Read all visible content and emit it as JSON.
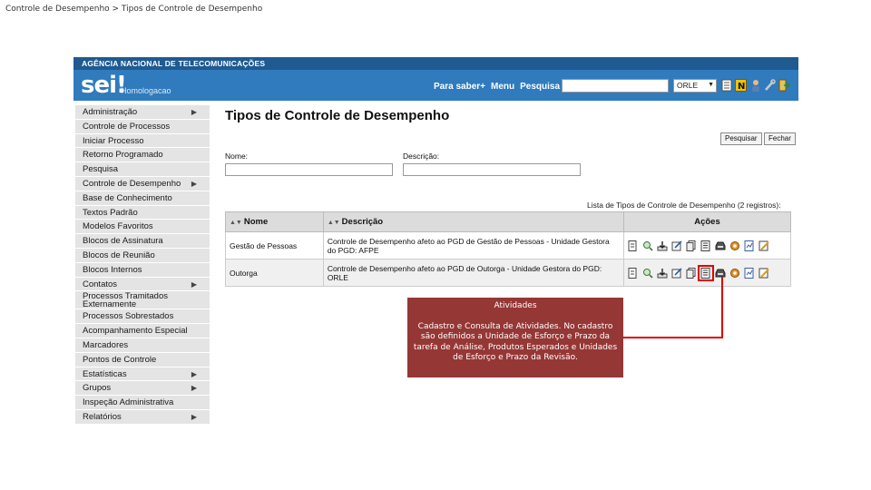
{
  "slide": {
    "title": "Controle de Desempenho > Tipos de Controle de Desempenho"
  },
  "header": {
    "agency": "AGÊNCIA NACIONAL DE TELECOMUNICAÇÕES",
    "logo": "sei!",
    "environment": "Homologacao",
    "links": [
      "Para saber+",
      "Menu",
      "Pesquisa"
    ],
    "search_value": "",
    "unit_value": "ORLE",
    "toolbar_icons": [
      "notes-icon",
      "n-icon",
      "user-icon",
      "tools-icon",
      "exit-icon"
    ]
  },
  "sidebar": {
    "items": [
      {
        "label": "Administração",
        "submenu": true
      },
      {
        "label": "Controle de Processos",
        "submenu": false
      },
      {
        "label": "Iniciar Processo",
        "submenu": false
      },
      {
        "label": "Retorno Programado",
        "submenu": false
      },
      {
        "label": "Pesquisa",
        "submenu": false
      },
      {
        "label": "Controle de Desempenho",
        "submenu": true
      },
      {
        "label": "Base de Conhecimento",
        "submenu": false
      },
      {
        "label": "Textos Padrão",
        "submenu": false
      },
      {
        "label": "Modelos Favoritos",
        "submenu": false
      },
      {
        "label": "Blocos de Assinatura",
        "submenu": false
      },
      {
        "label": "Blocos de Reunião",
        "submenu": false
      },
      {
        "label": "Blocos Internos",
        "submenu": false
      },
      {
        "label": "Contatos",
        "submenu": true
      },
      {
        "label": "Processos Tramitados Externamente",
        "submenu": false
      },
      {
        "label": "Processos Sobrestados",
        "submenu": false
      },
      {
        "label": "Acompanhamento Especial",
        "submenu": false
      },
      {
        "label": "Marcadores",
        "submenu": false
      },
      {
        "label": "Pontos de Controle",
        "submenu": false
      },
      {
        "label": "Estatísticas",
        "submenu": true
      },
      {
        "label": "Grupos",
        "submenu": true
      },
      {
        "label": "Inspeção Administrativa",
        "submenu": false
      },
      {
        "label": "Relatórios",
        "submenu": true
      }
    ]
  },
  "main": {
    "title": "Tipos de Controle de Desempenho",
    "buttons": {
      "search": "Pesquisar",
      "close": "Fechar"
    },
    "filters": {
      "name_label": "Nome:",
      "name_value": "",
      "description_label": "Descrição:",
      "description_value": ""
    },
    "table": {
      "caption": "Lista de Tipos de Controle de Desempenho (2 registros):",
      "headers": {
        "name": "Nome",
        "description": "Descrição",
        "actions": "Ações"
      },
      "rows": [
        {
          "name": "Gestão de Pessoas",
          "description": "Controle de Desempenho afeto ao PGD de Gestão de Pessoas - Unidade Gestora do PGD: AFPE"
        },
        {
          "name": "Outorga",
          "description": "Controle de Desempenho afeto ao PGD de Outorga - Unidade Gestora do PGD: ORLE"
        }
      ],
      "action_icons": [
        "document-icon",
        "search-doc-icon",
        "download-icon",
        "edit-icon",
        "copy-icon",
        "activities-icon",
        "tray-icon",
        "gear-icon",
        "report-icon",
        "pencil-icon"
      ]
    }
  },
  "tooltip": {
    "title": "Atividades",
    "body": "Cadastro e Consulta de Atividades. No cadastro são definidos a Unidade de Esforço e Prazo da tarefa de Análise, Produtos Esperados e Unidades de Esforço e Prazo da Revisão."
  },
  "colors": {
    "topbar": "#1f5a91",
    "brandbar": "#2f7bbd",
    "tooltip_bg": "#953735",
    "highlight": "#e00000"
  }
}
